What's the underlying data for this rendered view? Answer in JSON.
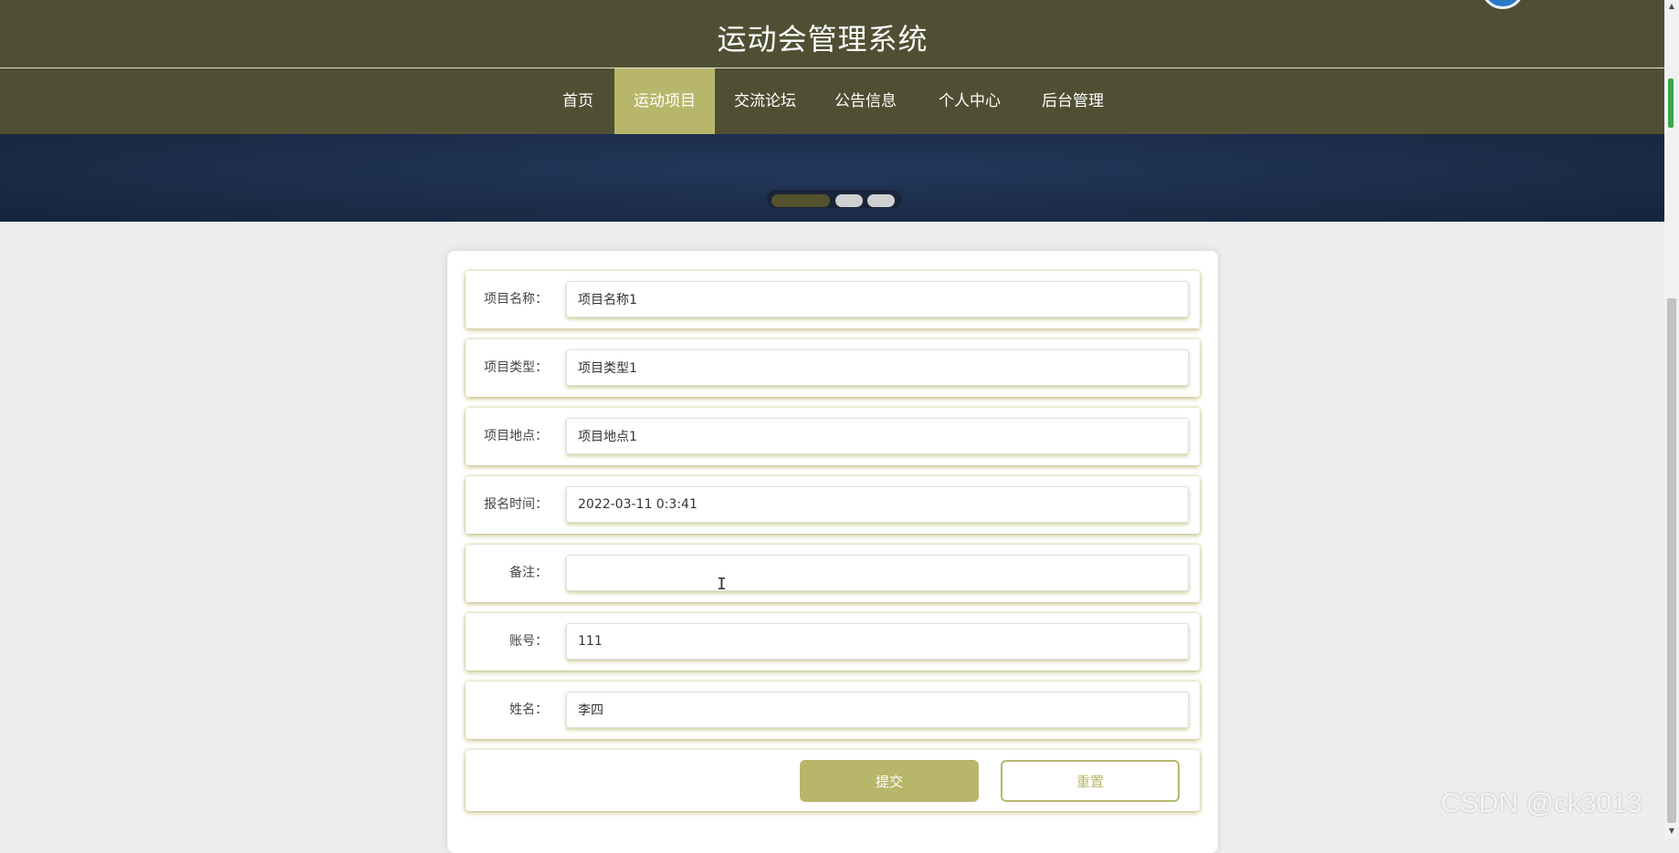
{
  "header": {
    "title": "运动会管理系统"
  },
  "nav": {
    "items": [
      {
        "label": "首页"
      },
      {
        "label": "运动项目",
        "active": true
      },
      {
        "label": "交流论坛"
      },
      {
        "label": "公告信息"
      },
      {
        "label": "个人中心"
      },
      {
        "label": "后台管理"
      }
    ]
  },
  "banner": {
    "slide_count": 3,
    "active_slide": 1
  },
  "form": {
    "fields": [
      {
        "label": "项目名称：",
        "value": "项目名称1"
      },
      {
        "label": "项目类型：",
        "value": "项目类型1"
      },
      {
        "label": "项目地点：",
        "value": "项目地点1"
      },
      {
        "label": "报名时间：",
        "value": "2022-03-11 0:3:41"
      },
      {
        "label": "备注：",
        "value": ""
      },
      {
        "label": "账号：",
        "value": "111"
      },
      {
        "label": "姓名：",
        "value": "李四"
      }
    ],
    "submit_label": "提交",
    "reset_label": "重置"
  },
  "watermark": "CSDN @ck3013",
  "colors": {
    "header_bg": "#4f4f33",
    "accent": "#b8b66b",
    "banner_bg": "#1b2c49",
    "page_bg": "#ededed"
  }
}
